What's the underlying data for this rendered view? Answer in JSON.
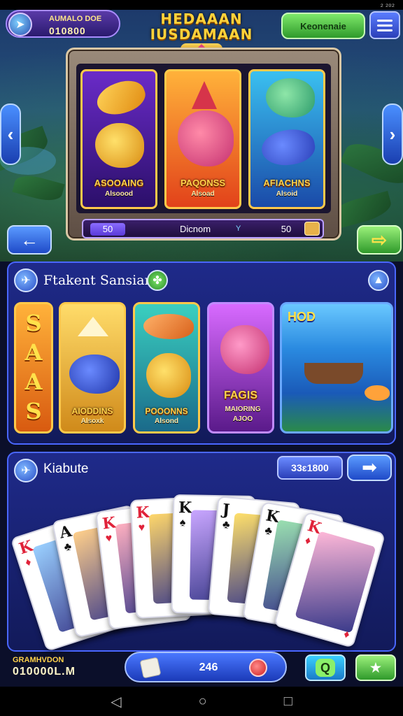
{
  "statusbar": {
    "right_text": "₂ ₂₀₂"
  },
  "player": {
    "name": "AUMALO DOE",
    "coins": "010800",
    "avatar_icon": "fish-emblem-icon"
  },
  "title": {
    "line1": "HEDAAAN",
    "line2": "IUSDAMAAN"
  },
  "header": {
    "green_button_label": "Keonenaie",
    "menu_icon": "hamburger-menu-icon"
  },
  "featured": {
    "cards": [
      {
        "caption": "ASOOAING",
        "subcaption": "Alsoood",
        "accent": "#7a3bd8"
      },
      {
        "caption": "PAQONSS",
        "subcaption": "Alsoad",
        "accent": "#f07a1a"
      },
      {
        "caption": "AFIACHNS",
        "subcaption": "Alsoid",
        "accent": "#2aa0e0"
      }
    ],
    "bar_left_value": "50",
    "bar_center_text": "Dicnom",
    "bar_cursor": "Y",
    "bar_right_value": "50"
  },
  "nav": {
    "prev_icon": "arrow-left-icon",
    "next_icon": "arrow-right-icon"
  },
  "section1": {
    "title": "Ftakent Sansian",
    "badge_icon": "clover-icon",
    "info_icon": "info-arrow-icon",
    "letters": [
      "S",
      "A",
      "A",
      "S"
    ],
    "cards": [
      {
        "caption": "AIODDINS",
        "subcaption": "Alsoxk"
      },
      {
        "caption": "POOONNS",
        "subcaption": "Alsond"
      },
      {
        "caption": "FAGIS",
        "subcaption": "MAIORING AJOO"
      }
    ],
    "scene_label": "HOD"
  },
  "section2": {
    "title": "Kiabute",
    "pill_value": "33ɛ1800",
    "cards": [
      {
        "rank": "K",
        "suit": "♦",
        "color": "#e0233a"
      },
      {
        "rank": "A",
        "suit": "♣",
        "color": "#111111"
      },
      {
        "rank": "K",
        "suit": "♥",
        "color": "#e0233a"
      },
      {
        "rank": "K",
        "suit": "♥",
        "color": "#e0233a"
      },
      {
        "rank": "K",
        "suit": "♠",
        "color": "#111111"
      },
      {
        "rank": "J",
        "suit": "♣",
        "color": "#111111"
      },
      {
        "rank": "K",
        "suit": "♣",
        "color": "#111111"
      },
      {
        "rank": "K",
        "suit": "♦",
        "color": "#e0233a"
      }
    ]
  },
  "bottom": {
    "name": "GRAMHVDON",
    "coins": "010000L.M",
    "pill_value": "246",
    "q_button": "Q",
    "star_icon": "star-icon"
  },
  "android_nav": {
    "back": "◁",
    "home": "○",
    "recent": "□"
  }
}
